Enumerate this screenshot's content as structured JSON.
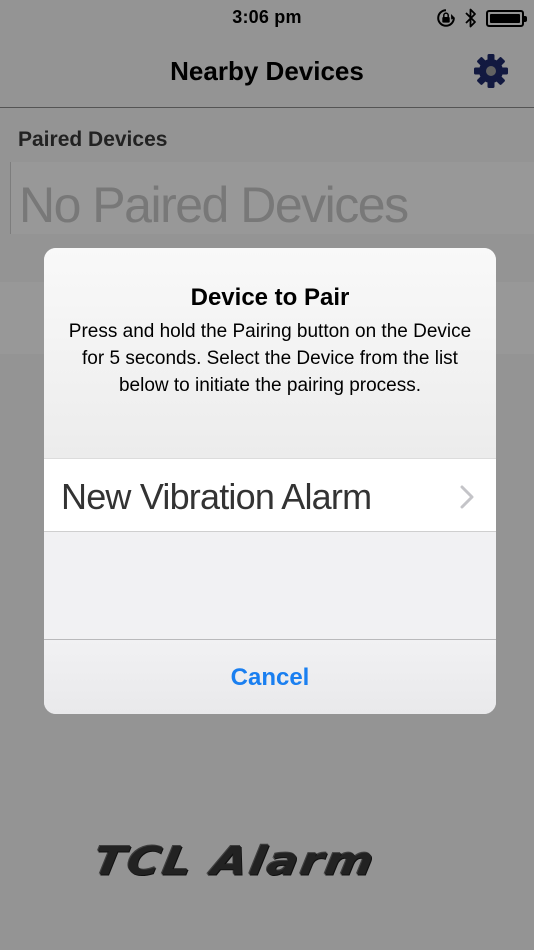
{
  "status_bar": {
    "time": "3:06 pm",
    "icons": [
      "rotation-lock-icon",
      "bluetooth-icon",
      "battery-icon"
    ],
    "battery_level": 1.0
  },
  "nav": {
    "title": "Nearby Devices",
    "settings_icon": "gear-icon",
    "accent_color": "#1f2a6b"
  },
  "paired": {
    "section_title": "Paired Devices",
    "empty_text": "No Paired Devices"
  },
  "dialog": {
    "title": "Device to Pair",
    "message": "Press and hold the Pairing button on the Device for 5 seconds. Select the Device from the list below to initiate the pairing process.",
    "devices": [
      {
        "name": "New Vibration Alarm"
      }
    ],
    "cancel_label": "Cancel",
    "cancel_color": "#1a7ff0"
  },
  "brand": {
    "logo_text": "TCL Alarm"
  }
}
